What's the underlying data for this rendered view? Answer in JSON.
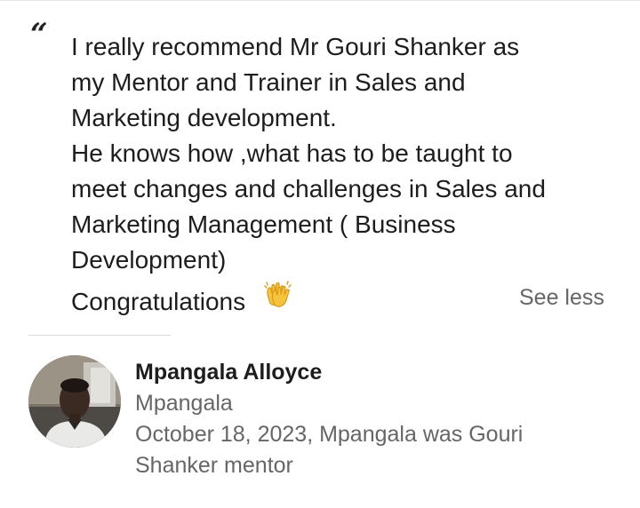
{
  "recommendation": {
    "quote_mark": "“",
    "text_lines": [
      "I really recommend Mr Gouri Shanker as",
      "my Mentor and Trainer in Sales and",
      "Marketing development.",
      "He knows how ,what has to be taught to",
      "meet changes and challenges in Sales and",
      "Marketing Management ( Business",
      "Development)",
      "Congratulations"
    ],
    "emoji_icon": "clapping-hands-icon",
    "see_less_label": "See less"
  },
  "author": {
    "name": "Mpangala Alloyce",
    "headline": "Mpangala",
    "relation": "October 18, 2023, Mpangala was Gouri Shanker mentor"
  },
  "colors": {
    "text_primary": "#1d1d1d",
    "text_secondary": "#666666",
    "divider": "#e8e8e8"
  }
}
